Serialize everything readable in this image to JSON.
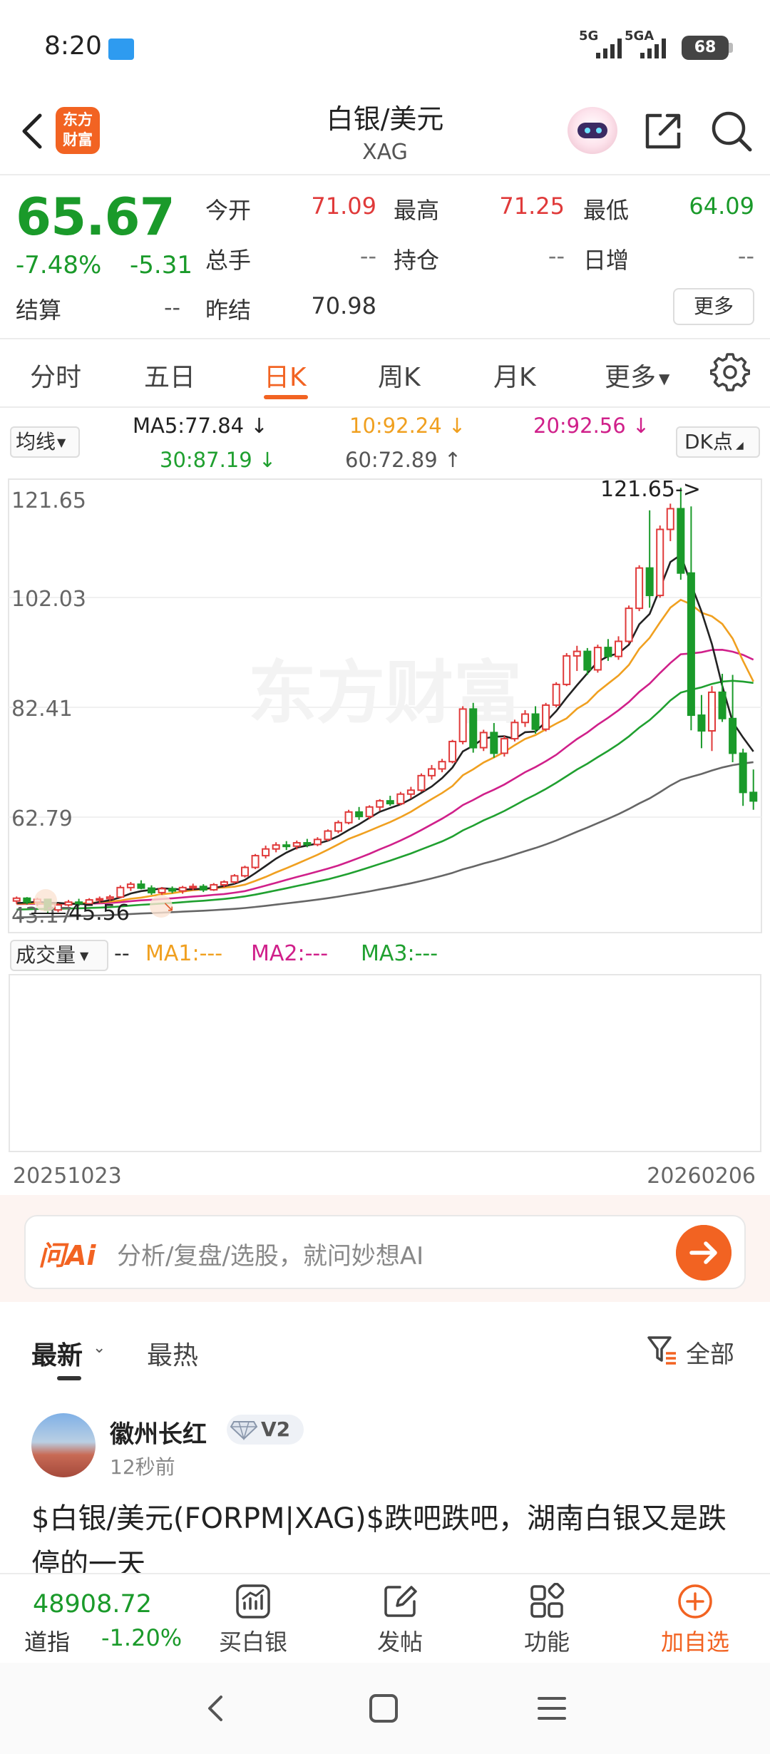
{
  "status": {
    "time": "8:20",
    "signal1": "5G",
    "signal2": "5GA",
    "battery": "68"
  },
  "header": {
    "title": "白银/美元",
    "subtitle": "XAG",
    "logo_text": "东方财富",
    "watermark": "东方财富"
  },
  "quote": {
    "price": "65.67",
    "change_pct": "-7.48%",
    "change_val": "-5.31",
    "open_label": "今开",
    "open": "71.09",
    "high_label": "最高",
    "high": "71.25",
    "low_label": "最低",
    "low": "64.09",
    "volume_label": "总手",
    "volume": "--",
    "oi_label": "持仓",
    "oi": "--",
    "daily_inc_label": "日增",
    "daily_inc": "--",
    "settle_label": "结算",
    "settle": "--",
    "prev_settle_label": "昨结",
    "prev_settle": "70.98",
    "more_label": "更多"
  },
  "tabs": [
    {
      "label": "分时"
    },
    {
      "label": "五日"
    },
    {
      "label": "日K"
    },
    {
      "label": "周K"
    },
    {
      "label": "月K"
    },
    {
      "label": "更多"
    }
  ],
  "ma_legend": {
    "select": "均线",
    "ma5": "MA5:77.84",
    "ma10": "10:92.24",
    "ma20": "20:92.56",
    "ma30": "30:87.19",
    "ma60": "60:72.89",
    "dk_select": "DK点"
  },
  "chart_data": {
    "type": "candlestick",
    "y_ticks": [
      "121.65",
      "102.03",
      "82.41",
      "62.79",
      "43.17"
    ],
    "ylim": [
      43.17,
      121.65
    ],
    "max_label": "121.65->",
    "min_label": "45.56",
    "date_start": "20251023",
    "date_end": "20260206",
    "colors": {
      "up": "#e03a3a",
      "down": "#1a9a2a",
      "ma5": "#222222",
      "ma10": "#f0a020",
      "ma20": "#d0208a",
      "ma30": "#20a030",
      "ma60": "#666666"
    },
    "ohlc": [
      [
        47.8,
        48.6,
        47.3,
        48.3
      ],
      [
        48.3,
        48.5,
        47.2,
        47.6
      ],
      [
        47.6,
        48.4,
        46.9,
        48.1
      ],
      [
        48.1,
        48.2,
        45.6,
        46.2
      ],
      [
        46.2,
        47.4,
        45.8,
        47.1
      ],
      [
        47.1,
        48.0,
        46.8,
        47.6
      ],
      [
        47.6,
        48.2,
        46.9,
        47.3
      ],
      [
        47.3,
        48.3,
        47.0,
        48.0
      ],
      [
        48.0,
        48.6,
        47.5,
        48.2
      ],
      [
        48.2,
        48.9,
        47.8,
        48.5
      ],
      [
        48.5,
        50.6,
        48.3,
        50.2
      ],
      [
        50.2,
        51.2,
        49.6,
        50.8
      ],
      [
        50.8,
        51.5,
        49.9,
        50.1
      ],
      [
        50.1,
        50.6,
        48.9,
        49.3
      ],
      [
        49.3,
        50.3,
        48.8,
        50.0
      ],
      [
        50.0,
        50.4,
        49.2,
        49.6
      ],
      [
        49.6,
        50.5,
        49.1,
        50.2
      ],
      [
        50.2,
        50.9,
        49.7,
        50.4
      ],
      [
        50.4,
        50.8,
        49.4,
        49.8
      ],
      [
        49.8,
        51.0,
        49.6,
        50.7
      ],
      [
        50.7,
        51.5,
        50.2,
        51.2
      ],
      [
        51.2,
        52.6,
        50.9,
        52.3
      ],
      [
        52.3,
        54.1,
        52.0,
        53.8
      ],
      [
        53.8,
        56.2,
        53.5,
        55.9
      ],
      [
        55.9,
        57.7,
        55.4,
        57.1
      ],
      [
        57.1,
        58.3,
        56.5,
        57.8
      ],
      [
        57.8,
        58.5,
        56.9,
        57.6
      ],
      [
        57.6,
        58.6,
        57.0,
        58.2
      ],
      [
        58.2,
        58.9,
        57.4,
        57.9
      ],
      [
        57.9,
        59.2,
        57.6,
        58.8
      ],
      [
        58.8,
        60.6,
        58.5,
        60.3
      ],
      [
        60.3,
        62.2,
        59.9,
        61.8
      ],
      [
        61.8,
        64.1,
        61.5,
        63.7
      ],
      [
        63.7,
        64.6,
        62.3,
        62.9
      ],
      [
        62.9,
        64.9,
        62.4,
        64.6
      ],
      [
        64.6,
        66.0,
        63.9,
        65.7
      ],
      [
        65.7,
        66.6,
        64.8,
        65.2
      ],
      [
        65.2,
        67.3,
        64.9,
        66.9
      ],
      [
        66.9,
        68.2,
        66.1,
        67.6
      ],
      [
        67.6,
        70.6,
        67.3,
        70.2
      ],
      [
        70.2,
        72.1,
        69.5,
        71.4
      ],
      [
        71.4,
        73.2,
        70.8,
        72.7
      ],
      [
        72.7,
        76.6,
        72.4,
        76.3
      ],
      [
        76.3,
        82.6,
        75.8,
        82.1
      ],
      [
        82.1,
        83.2,
        74.3,
        75.2
      ],
      [
        75.2,
        78.4,
        74.6,
        77.9
      ],
      [
        77.9,
        79.6,
        73.4,
        74.2
      ],
      [
        74.2,
        77.3,
        73.6,
        76.8
      ],
      [
        76.8,
        80.2,
        76.3,
        79.7
      ],
      [
        79.7,
        81.9,
        78.9,
        81.2
      ],
      [
        81.2,
        82.6,
        77.7,
        78.5
      ],
      [
        78.5,
        83.2,
        78.1,
        82.8
      ],
      [
        82.8,
        86.9,
        82.4,
        86.5
      ],
      [
        86.5,
        92.1,
        86.2,
        91.6
      ],
      [
        91.6,
        93.4,
        88.9,
        92.4
      ],
      [
        92.4,
        93.0,
        88.2,
        89.1
      ],
      [
        89.1,
        93.6,
        88.6,
        93.1
      ],
      [
        93.1,
        94.6,
        90.7,
        91.5
      ],
      [
        91.5,
        95.1,
        90.9,
        94.2
      ],
      [
        94.2,
        100.6,
        93.8,
        100.1
      ],
      [
        100.1,
        107.8,
        99.6,
        107.3
      ],
      [
        107.3,
        117.6,
        100.2,
        102.4
      ],
      [
        102.4,
        114.9,
        102.0,
        114.2
      ],
      [
        114.2,
        118.8,
        112.1,
        117.9
      ],
      [
        117.9,
        121.65,
        105.2,
        106.4
      ],
      [
        106.4,
        118.3,
        78.3,
        81.0
      ],
      [
        81.0,
        84.6,
        75.1,
        78.2
      ],
      [
        78.2,
        86.2,
        74.6,
        85.1
      ],
      [
        85.1,
        88.4,
        79.8,
        80.4
      ],
      [
        80.4,
        88.2,
        72.6,
        74.2
      ],
      [
        74.2,
        75.0,
        64.8,
        67.2
      ],
      [
        67.2,
        71.3,
        64.1,
        65.67
      ]
    ]
  },
  "volume": {
    "select": "成交量",
    "sep": "--",
    "ma1": "MA1:---",
    "ma2": "MA2:---",
    "ma3": "MA3:---"
  },
  "ai": {
    "logo": "问Ai",
    "placeholder": "分析/复盘/选股，就问妙想AI"
  },
  "feed": {
    "tab_new": "最新",
    "tab_hot": "最热",
    "filter": "全部",
    "post": {
      "author": "徽州长红",
      "level": "V2",
      "time": "12秒前",
      "text": "$白银/美元(FORPM|XAG)$跌吧跌吧，湖南白银又是跌停的一天"
    }
  },
  "bottom": {
    "index_value": "48908.72",
    "index_label": "道指",
    "index_change": "-1.20%",
    "buy": "买白银",
    "post": "发帖",
    "func": "功能",
    "watch": "加自选"
  }
}
